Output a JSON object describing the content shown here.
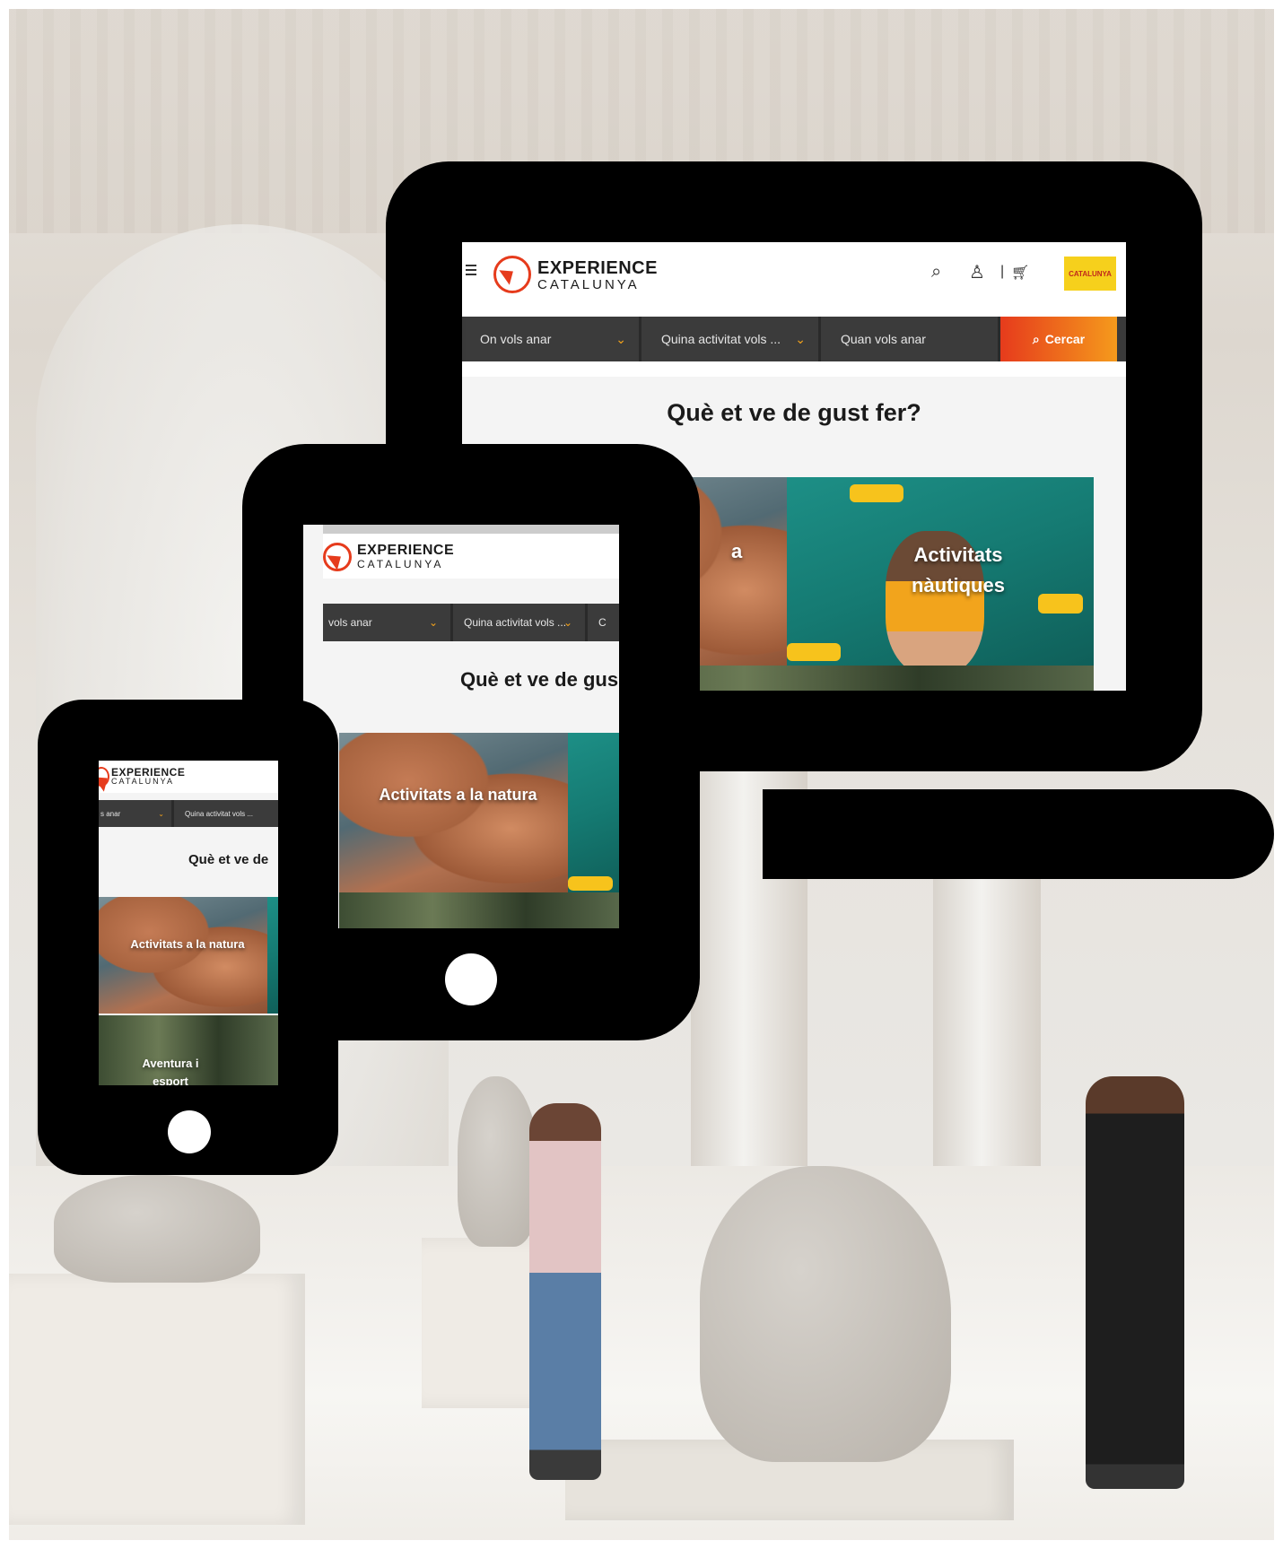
{
  "brand": {
    "line1": "EXPERIENCE",
    "line2": "CATALUNYA",
    "partner_logo": "CATALUNYA",
    "accent": "#e63b1c",
    "accent2": "#f59a1c"
  },
  "desktop": {
    "search": {
      "where": "On vols anar",
      "activity": "Quina activitat vols ...",
      "when": "Quan vols anar",
      "submit": "Cercar"
    },
    "headline": "Què et ve de gust fer?",
    "tiles": [
      "a",
      "Activitats nàutiques"
    ]
  },
  "tablet": {
    "search": {
      "where": "vols anar",
      "activity": "Quina activitat vols ...",
      "cut": "C"
    },
    "headline": "Què et ve de gus",
    "tiles": [
      "Activitats a la natura"
    ]
  },
  "phone": {
    "search": {
      "where": "s anar",
      "activity": "Quina activitat vols ..."
    },
    "headline": "Què et ve de",
    "tiles": [
      "Activitats a la natura",
      "Aventura i esport"
    ]
  }
}
